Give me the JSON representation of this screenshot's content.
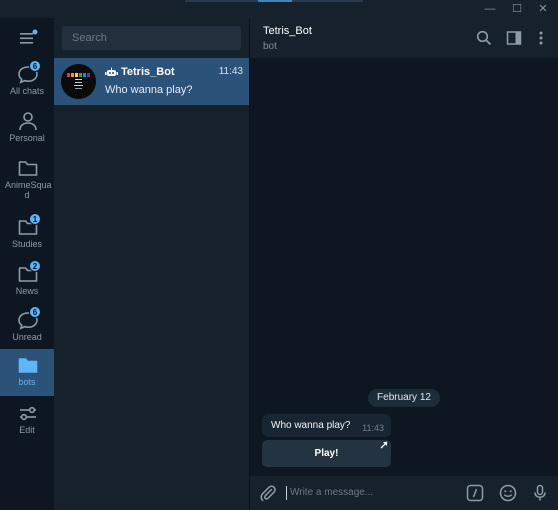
{
  "window": {
    "minimize_glyph": "—",
    "maximize_glyph": "☐",
    "close_glyph": "✕"
  },
  "folders": [
    {
      "label": "All chats",
      "badge": "6",
      "icon": "chat-bubbles-icon"
    },
    {
      "label": "Personal",
      "badge": "",
      "icon": "person-icon"
    },
    {
      "label": "AnimeSqua d",
      "badge": "",
      "icon": "folder-icon"
    },
    {
      "label": "Studies",
      "badge": "1",
      "icon": "folder-icon"
    },
    {
      "label": "News",
      "badge": "2",
      "icon": "folder-icon"
    },
    {
      "label": "Unread",
      "badge": "6",
      "icon": "chat-bubble-icon"
    },
    {
      "label": "bots",
      "badge": "",
      "icon": "folder-filled-icon",
      "active": true
    },
    {
      "label": "Edit",
      "badge": "",
      "icon": "sliders-icon"
    }
  ],
  "search": {
    "placeholder": "Search"
  },
  "chats": [
    {
      "name": "Tetris_Bot",
      "time": "11:43",
      "last_message": "Who wanna play?"
    }
  ],
  "conversation": {
    "title": "Tetris_Bot",
    "subtitle": "bot",
    "date_separator": "February 12",
    "messages": [
      {
        "text": "Who wanna play?",
        "time": "11:43"
      }
    ],
    "inline_button": "Play!"
  },
  "composer": {
    "placeholder": "Write a message..."
  },
  "colors": {
    "accent": "#5eb5f7",
    "selected": "#2b5278",
    "background": "#0e1621",
    "panel": "#17212b"
  }
}
